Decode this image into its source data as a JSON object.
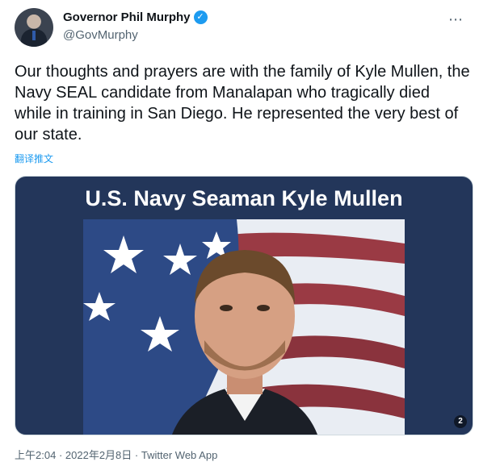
{
  "author": {
    "display_name": "Governor Phil Murphy",
    "handle": "@GovMurphy",
    "verified_icon": "verified-badge-icon"
  },
  "tweet": {
    "text": "Our thoughts and prayers are with the family of Kyle Mullen, the Navy SEAL candidate from Manalapan who tragically died while in training in San Diego. He represented the very best of our state.",
    "translate_label": "翻译推文"
  },
  "media": {
    "title": "U.S. Navy Seaman Kyle Mullen",
    "count_badge": "2"
  },
  "meta": {
    "time": "上午2:04",
    "separator": "·",
    "date": "2022年2月8日",
    "source": "Twitter Web App"
  },
  "icons": {
    "more": "more-icon"
  },
  "colors": {
    "accent": "#1d9bf0",
    "media_bg": "#23365a"
  }
}
